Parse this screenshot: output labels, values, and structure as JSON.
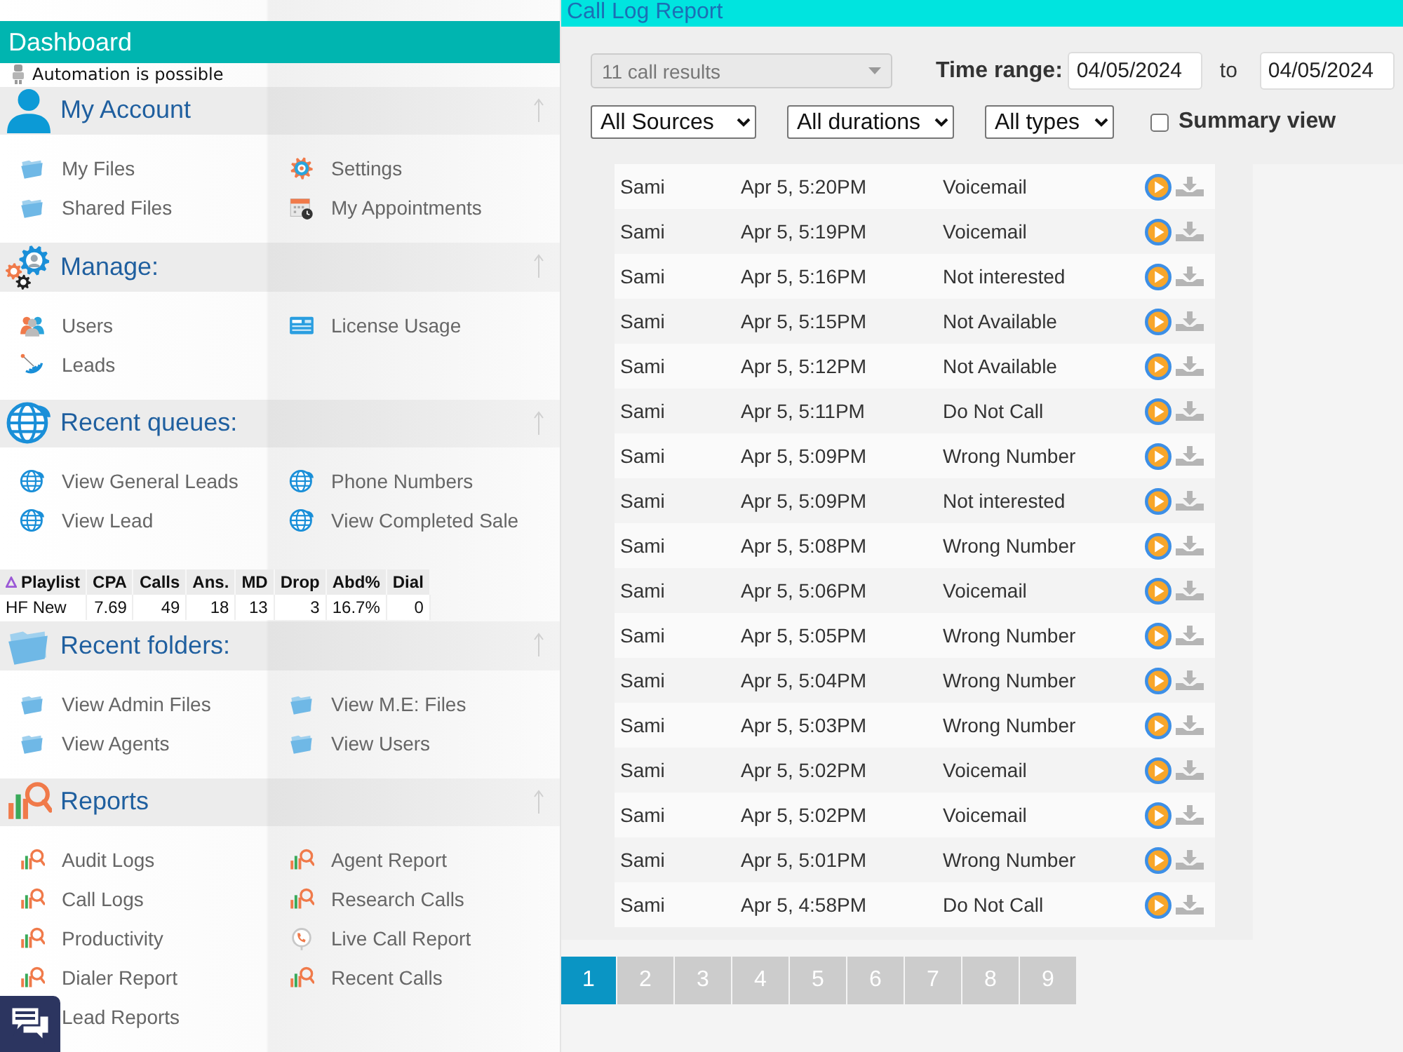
{
  "sidebar": {
    "title": "Dashboard",
    "notice": "Automation is possible",
    "sections": [
      {
        "title": "My Account",
        "kind": "person",
        "items": [
          {
            "label": "My Files",
            "kind": "folder"
          },
          {
            "label": "Settings",
            "kind": "settings"
          },
          {
            "label": "Shared Files",
            "kind": "folder"
          },
          {
            "label": "My Appointments",
            "kind": "calendar"
          }
        ]
      },
      {
        "title": "Manage:",
        "kind": "gears",
        "items": [
          {
            "label": "Users",
            "kind": "users"
          },
          {
            "label": "License Usage",
            "kind": "card"
          },
          {
            "label": "Leads",
            "kind": "dish"
          }
        ]
      },
      {
        "title": "Recent queues:",
        "kind": "globe",
        "items": [
          {
            "label": "View General Leads",
            "kind": "globe"
          },
          {
            "label": "Phone Numbers",
            "kind": "globe"
          },
          {
            "label": "View Lead",
            "kind": "globe"
          },
          {
            "label": "View Completed Sale",
            "kind": "globe"
          }
        ],
        "table": {
          "columns": [
            {
              "label": "Playlist",
              "sorted": true
            },
            {
              "label": "CPA",
              "sorted": false
            },
            {
              "label": "Calls",
              "sorted": false
            },
            {
              "label": "Ans.",
              "sorted": false
            },
            {
              "label": "MD",
              "sorted": false
            },
            {
              "label": "Drop",
              "sorted": false
            },
            {
              "label": "Abd%",
              "sorted": false
            },
            {
              "label": "Dial",
              "sorted": false
            }
          ],
          "rows": [
            [
              "HF New",
              "7.69",
              "49",
              "18",
              "13",
              "3",
              "16.7%",
              "0"
            ]
          ]
        }
      },
      {
        "title": "Recent folders:",
        "kind": "folder",
        "items": [
          {
            "label": "View Admin Files",
            "kind": "folder"
          },
          {
            "label": "View M.E: Files",
            "kind": "folder"
          },
          {
            "label": "View Agents",
            "kind": "folder"
          },
          {
            "label": "View Users",
            "kind": "folder"
          }
        ]
      },
      {
        "title": "Reports",
        "kind": "chart",
        "items": [
          {
            "label": "Audit Logs",
            "kind": "chart"
          },
          {
            "label": "Agent Report",
            "kind": "chart"
          },
          {
            "label": "Call Logs",
            "kind": "chart"
          },
          {
            "label": "Research Calls",
            "kind": "chart"
          },
          {
            "label": "Productivity",
            "kind": "chart"
          },
          {
            "label": "Live Call Report",
            "kind": "phone"
          },
          {
            "label": "Dialer Report",
            "kind": "chart"
          },
          {
            "label": "Recent Calls",
            "kind": "chart"
          },
          {
            "label": "Lead Reports",
            "kind": "plain"
          }
        ]
      }
    ]
  },
  "report": {
    "title": "Call Log Report",
    "filters": {
      "results": {
        "value": "11 call results",
        "disabled": true
      },
      "time_range_label": "Time range:",
      "date_from": "04/05/2024",
      "to_label": "to",
      "date_to": "04/05/2024",
      "selects": [
        "All Sources",
        "All durations",
        "All types"
      ],
      "summary_view": {
        "label": "Summary view",
        "checked": false
      }
    },
    "calls": [
      {
        "agent": "Sami",
        "time": "Apr 5, 5:20PM",
        "result": "Voicemail"
      },
      {
        "agent": "Sami",
        "time": "Apr 5, 5:19PM",
        "result": "Voicemail"
      },
      {
        "agent": "Sami",
        "time": "Apr 5, 5:16PM",
        "result": "Not interested"
      },
      {
        "agent": "Sami",
        "time": "Apr 5, 5:15PM",
        "result": "Not Available"
      },
      {
        "agent": "Sami",
        "time": "Apr 5, 5:12PM",
        "result": "Not Available"
      },
      {
        "agent": "Sami",
        "time": "Apr 5, 5:11PM",
        "result": "Do Not Call"
      },
      {
        "agent": "Sami",
        "time": "Apr 5, 5:09PM",
        "result": "Wrong Number"
      },
      {
        "agent": "Sami",
        "time": "Apr 5, 5:09PM",
        "result": "Not interested"
      },
      {
        "agent": "Sami",
        "time": "Apr 5, 5:08PM",
        "result": "Wrong Number"
      },
      {
        "agent": "Sami",
        "time": "Apr 5, 5:06PM",
        "result": "Voicemail"
      },
      {
        "agent": "Sami",
        "time": "Apr 5, 5:05PM",
        "result": "Wrong Number"
      },
      {
        "agent": "Sami",
        "time": "Apr 5, 5:04PM",
        "result": "Wrong Number"
      },
      {
        "agent": "Sami",
        "time": "Apr 5, 5:03PM",
        "result": "Wrong Number"
      },
      {
        "agent": "Sami",
        "time": "Apr 5, 5:02PM",
        "result": "Voicemail"
      },
      {
        "agent": "Sami",
        "time": "Apr 5, 5:02PM",
        "result": "Voicemail"
      },
      {
        "agent": "Sami",
        "time": "Apr 5, 5:01PM",
        "result": "Wrong Number"
      },
      {
        "agent": "Sami",
        "time": "Apr 5, 4:58PM",
        "result": "Do Not Call"
      }
    ],
    "pagination": [
      {
        "label": "1",
        "selected": true
      },
      {
        "label": "2",
        "selected": false
      },
      {
        "label": "3",
        "selected": false
      },
      {
        "label": "4",
        "selected": false
      },
      {
        "label": "5",
        "selected": false
      },
      {
        "label": "6",
        "selected": false
      },
      {
        "label": "7",
        "selected": false
      },
      {
        "label": "8",
        "selected": false
      },
      {
        "label": "9",
        "selected": false
      }
    ]
  }
}
